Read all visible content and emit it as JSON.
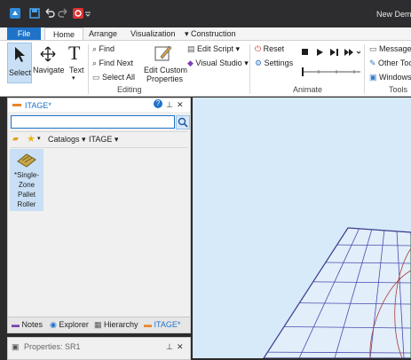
{
  "window": {
    "title": "New Demo"
  },
  "qat": {
    "items": [
      "app-icon",
      "save-icon",
      "undo-icon",
      "redo-icon",
      "record-icon",
      "customize-icon"
    ]
  },
  "ribbon_tabs": [
    {
      "label": "File"
    },
    {
      "label": "Home"
    },
    {
      "label": "Arrange"
    },
    {
      "label": "Visualization"
    },
    {
      "label": "Construction"
    }
  ],
  "ribbon": {
    "select": "Select",
    "navigate": "Navigate",
    "text": "Text",
    "find": "Find",
    "find_next": "Find Next",
    "select_all": "Select All",
    "edit_custom": [
      "Edit Custom",
      "Properties"
    ],
    "edit_script": "Edit Script",
    "visual_studio": "Visual Studio",
    "reset": "Reset",
    "settings": "Settings",
    "message": "Message L",
    "other_tools": "Other Too",
    "windows": "Windows",
    "groups": {
      "editing": "Editing",
      "animate": "Animate",
      "tools": "Tools"
    }
  },
  "library_panel": {
    "title": "ITAGE*",
    "search_value": "",
    "breadcrumb": [
      "Catalogs",
      "ITAGE"
    ],
    "items": [
      {
        "label_lines": [
          "*Single-",
          "Zone",
          "Pallet",
          "Roller"
        ]
      }
    ],
    "bottom_tabs": [
      "Notes",
      "Explorer",
      "Hierarchy",
      "ITAGE*"
    ]
  },
  "properties_panel": {
    "title": "Properties: SR1"
  }
}
